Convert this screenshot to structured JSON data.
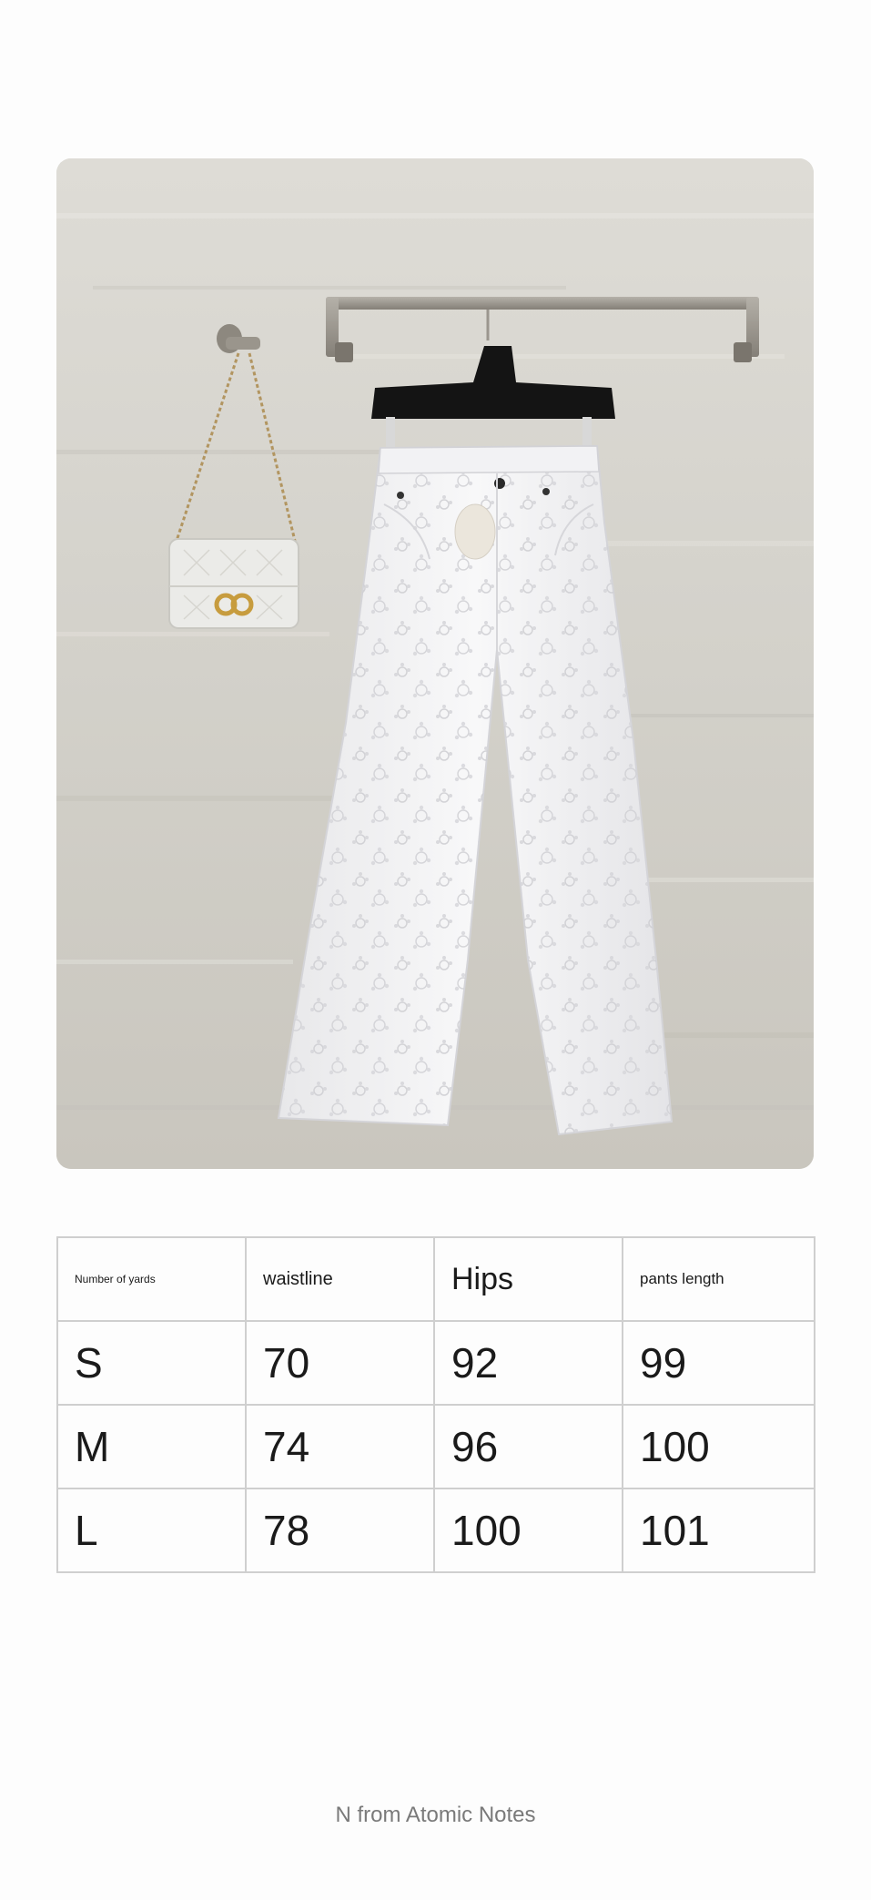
{
  "product_image": {
    "alt": "White embroidered wide-leg jeans hanging on a rail next to a small white quilted shoulder bag",
    "colors": {
      "wall": "#d8d6cf",
      "rail": "#9c978e",
      "hanger": "#111111",
      "pants": "#f3f3f4",
      "bag": "#ebebe8",
      "chain": "#b29560",
      "clasp": "#c79c3e"
    }
  },
  "size_table": {
    "headers": [
      "Number of yards",
      "waistline",
      "Hips",
      "pants length"
    ],
    "rows": [
      {
        "size": "S",
        "waistline": "70",
        "hips": "92",
        "pants_length": "99"
      },
      {
        "size": "M",
        "waistline": "74",
        "hips": "96",
        "pants_length": "100"
      },
      {
        "size": "L",
        "waistline": "78",
        "hips": "100",
        "pants_length": "101"
      }
    ]
  },
  "footer": {
    "text": "N from Atomic Notes"
  }
}
